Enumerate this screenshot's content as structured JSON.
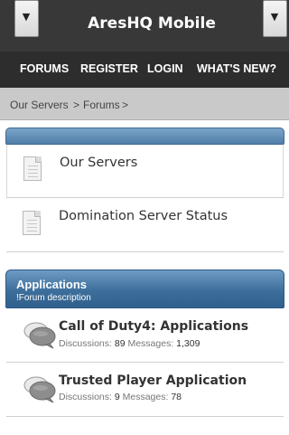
{
  "header": {
    "title": "AresHQ Mobile",
    "left_menu_icon": "chevron-down-icon",
    "right_menu_icon": "chevron-down-icon"
  },
  "nav": {
    "items": [
      "FORUMS",
      "REGISTER",
      "LOGIN",
      "WHAT'S NEW?"
    ]
  },
  "breadcrumb": {
    "items": [
      "Our Servers",
      "Forums"
    ],
    "separator": ">"
  },
  "sections": [
    {
      "title": "",
      "nodes": [
        {
          "title": "Our Servers",
          "icon": "document-icon"
        },
        {
          "title": "Domination Server Status",
          "icon": "document-icon"
        }
      ]
    },
    {
      "title": "Applications",
      "description": "!Forum description",
      "forums": [
        {
          "title": "Call of Duty4: Applications",
          "icon": "speech-bubbles-icon",
          "discussions_label": "Discussions:",
          "discussions": "89",
          "messages_label": "Messages:",
          "messages": "1,309"
        },
        {
          "title": "Trusted Player Application",
          "icon": "speech-bubbles-icon",
          "discussions_label": "Discussions:",
          "discussions": "9",
          "messages_label": "Messages:",
          "messages": "78"
        }
      ]
    }
  ],
  "colors": {
    "header_bg": "#383838",
    "nav_bg": "#2d2d2d",
    "breadcrumb_bg": "#c9c9c9",
    "section_blue": "#3e6f9c"
  }
}
